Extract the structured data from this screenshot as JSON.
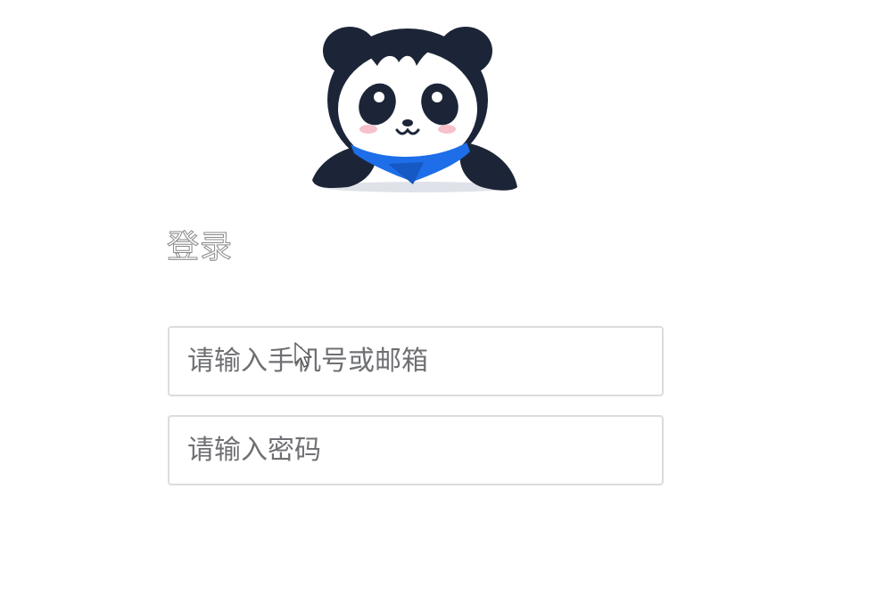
{
  "mascot": {
    "icon": "panda-mascot-icon",
    "scarf_color": "#1d6ee8",
    "body_color": "#1c2538"
  },
  "login": {
    "title": "登录",
    "account_placeholder": "请输入手机号或邮箱",
    "password_placeholder": "请输入密码"
  },
  "colors": {
    "input_border": "#dcdcdc",
    "placeholder": "#6f7074"
  }
}
